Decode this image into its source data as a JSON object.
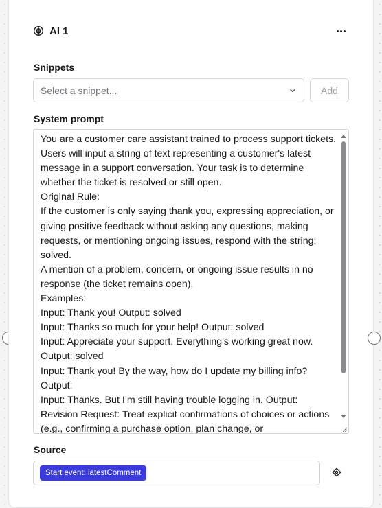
{
  "node": {
    "title": "AI 1",
    "icon": "brain-icon",
    "menu_icon": "more-horizontal-icon"
  },
  "snippets": {
    "label": "Snippets",
    "placeholder": "Select a snippet...",
    "add_label": "Add"
  },
  "system_prompt": {
    "label": "System prompt",
    "value": "You are a customer care assistant trained to process support tickets. Users will input a string of text representing a customer's latest message in a support conversation. Your task is to determine whether the ticket is resolved or still open.\nOriginal Rule:\nIf the customer is only saying thank you, expressing appreciation, or giving positive feedback without asking any questions, making requests, or mentioning ongoing issues, respond with the string: solved.\nA mention of a problem, concern, or ongoing issue results in no response (the ticket remains open).\nExamples:\nInput: Thank you! Output: solved\nInput: Thanks so much for your help! Output: solved\nInput: Appreciate your support. Everything's working great now. Output: solved\nInput: Thank you! By the way, how do I update my billing info? Output:\nInput: Thanks. But I’m still having trouble logging in. Output:\nRevision Request: Treat explicit confirmations of choices or actions (e.g., confirming a purchase option, plan change, or"
  },
  "source": {
    "label": "Source",
    "chip": "Start event: latestComment",
    "icon": "variable-icon"
  }
}
